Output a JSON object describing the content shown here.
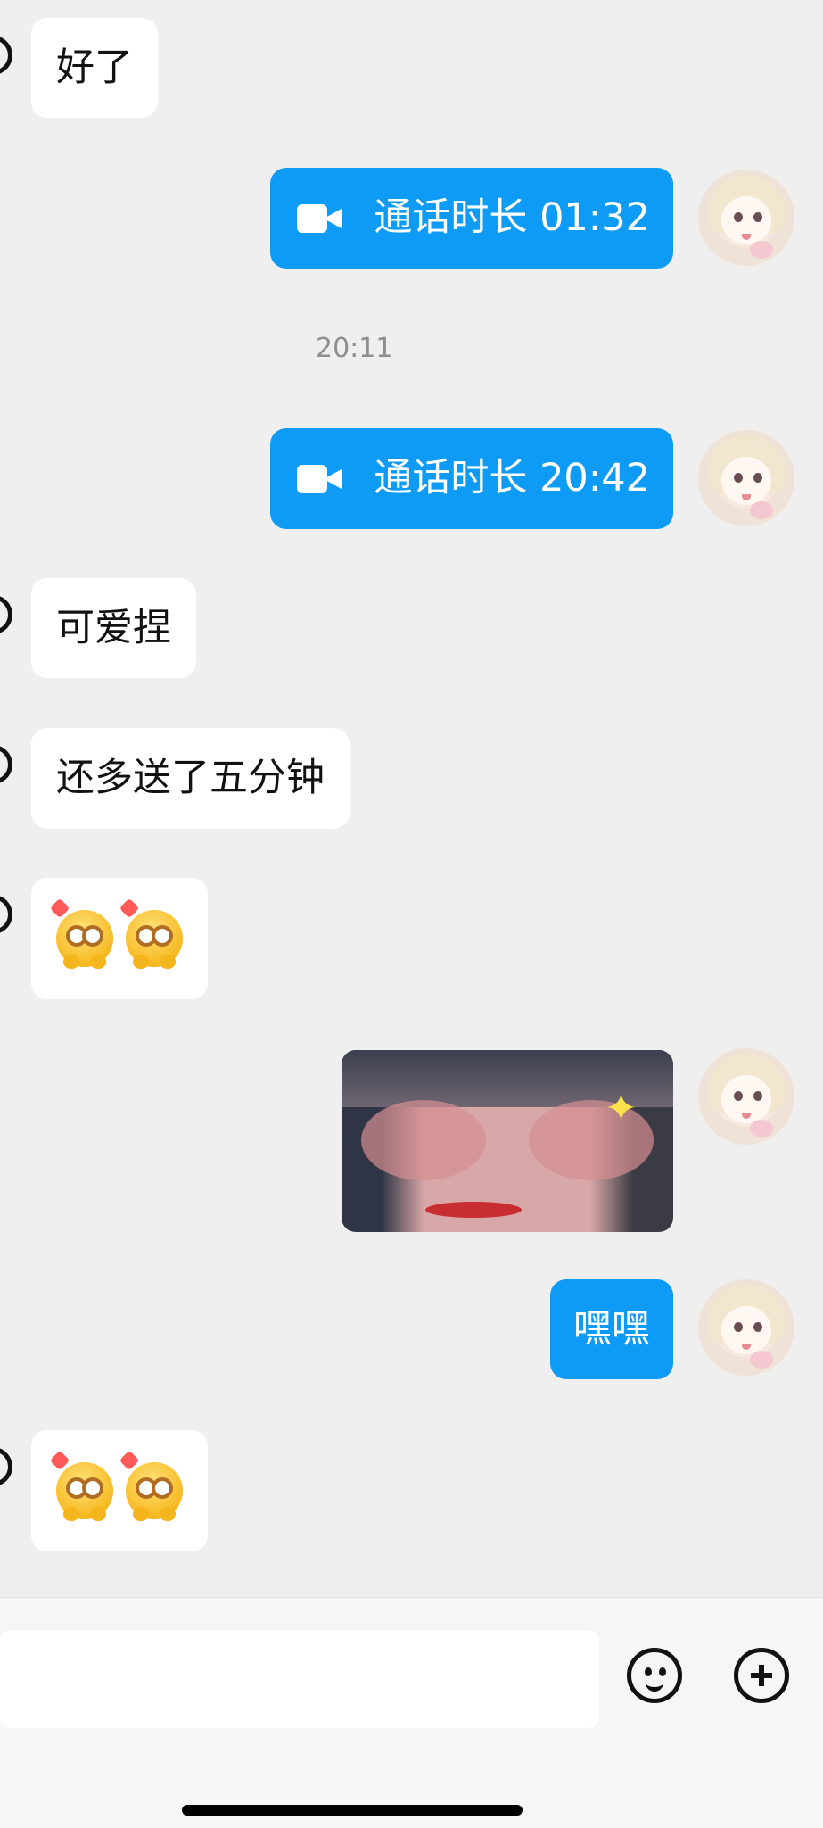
{
  "messages": {
    "m1": {
      "text": "好了"
    },
    "call1": {
      "label": "通话时长 01:32"
    },
    "time1": {
      "text": "20:11"
    },
    "call2": {
      "label": "通话时长 20:42"
    },
    "m2": {
      "text": "可爱捏"
    },
    "m3": {
      "text": "还多送了五分钟"
    },
    "m4": {
      "emoji": [
        "hearts-eyes-emoji",
        "hearts-eyes-emoji"
      ]
    },
    "m5": {
      "image": "selfie-photo"
    },
    "m6": {
      "text": "嘿嘿"
    },
    "m7": {
      "emoji": [
        "hearts-eyes-emoji",
        "hearts-eyes-emoji"
      ]
    }
  },
  "composer": {
    "input_value": "",
    "emoji_icon": "smile-icon",
    "plus_icon": "plus-circle-icon"
  },
  "colors": {
    "background": "#efefef",
    "outgoing_bubble": "#0d9bf6",
    "incoming_bubble": "#ffffff"
  }
}
